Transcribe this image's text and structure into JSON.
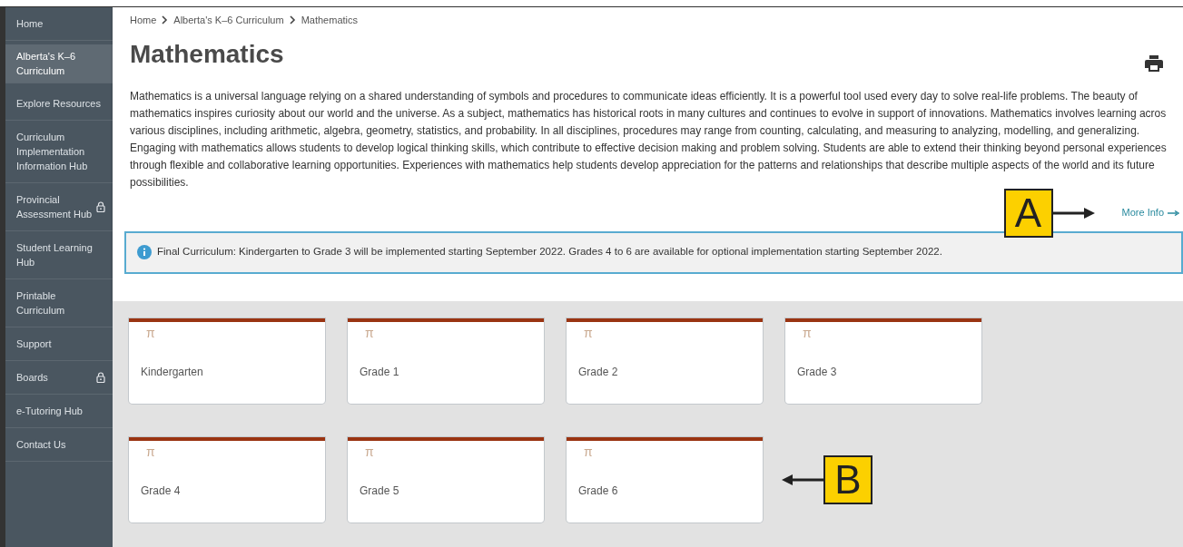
{
  "sidebar": {
    "items": [
      {
        "label": "Home",
        "selected": false,
        "locked": false
      },
      {
        "label": "Alberta's K–6 Curriculum",
        "selected": true,
        "locked": false
      },
      {
        "label": "Explore Resources",
        "selected": false,
        "locked": false
      },
      {
        "label": "Curriculum Implementation Information Hub",
        "selected": false,
        "locked": false
      },
      {
        "label": "Provincial Assessment Hub",
        "selected": false,
        "locked": true
      },
      {
        "label": "Student Learning Hub",
        "selected": false,
        "locked": false
      },
      {
        "label": "Printable Curriculum",
        "selected": false,
        "locked": false
      },
      {
        "label": "Support",
        "selected": false,
        "locked": false
      },
      {
        "label": "Boards",
        "selected": false,
        "locked": true
      },
      {
        "label": "e-Tutoring Hub",
        "selected": false,
        "locked": false
      },
      {
        "label": "Contact Us",
        "selected": false,
        "locked": false
      }
    ]
  },
  "breadcrumb": [
    "Home",
    "Alberta's K–6 Curriculum",
    "Mathematics"
  ],
  "title": "Mathematics",
  "description": [
    "Mathematics is a universal language relying on a shared understanding of symbols and procedures to communicate ideas efficiently. It is a powerful tool used every day to solve real-life problems. The beauty of",
    "mathematics inspires curiosity about our world and the universe. As a subject, mathematics has historical roots in many cultures and continues to evolve in support of innovations. Mathematics involves learning acros",
    "various disciplines, including arithmetic, algebra, geometry, statistics, and probability. In all disciplines, procedures may range from counting, calculating, and measuring to analyzing, modelling, and generalizing.",
    "Engaging with mathematics allows students to develop logical thinking skills, which contribute to effective decision making and problem solving. Students are able to extend their thinking beyond personal experiences",
    "through flexible and collaborative learning opportunities. Experiences with mathematics help students develop appreciation for the patterns and relationships that describe multiple aspects of the world and its future",
    "possibilities."
  ],
  "more_info": "More Info",
  "notice": "Final Curriculum: Kindergarten to Grade 3 will be implemented starting September 2022. Grades 4 to 6 are available for optional implementation starting September 2022.",
  "cards": [
    {
      "icon": "π",
      "label": "Kindergarten"
    },
    {
      "icon": "π",
      "label": "Grade 1"
    },
    {
      "icon": "π",
      "label": "Grade 2"
    },
    {
      "icon": "π",
      "label": "Grade 3"
    },
    {
      "icon": "π",
      "label": "Grade 4"
    },
    {
      "icon": "π",
      "label": "Grade 5"
    },
    {
      "icon": "π",
      "label": "Grade 6"
    }
  ],
  "annotations": [
    {
      "label": "A",
      "kind": "arrow-right"
    },
    {
      "label": "B",
      "kind": "arrow-left"
    }
  ]
}
